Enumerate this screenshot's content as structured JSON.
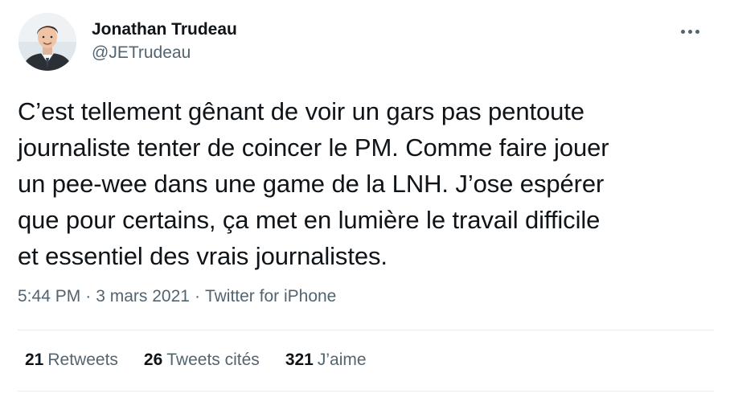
{
  "author": {
    "name": "Jonathan Trudeau",
    "handle": "@JETrudeau"
  },
  "tweet": {
    "lines": [
      "C’est tellement gênant de voir un gars pas pentoute",
      "journaliste tenter de coincer le PM. Comme faire jouer",
      "un pee-wee dans une game de la LNH. J’ose espérer",
      "que pour certains, ça met en lumière le travail difficile",
      "et essentiel des vrais journalistes."
    ]
  },
  "meta": {
    "time": "5:44 PM",
    "separator": "·",
    "date": "3 mars 2021",
    "source": "Twitter for iPhone"
  },
  "stats": {
    "retweets": {
      "count": "21",
      "label": "Retweets"
    },
    "quotes": {
      "count": "26",
      "label": "Tweets cités"
    },
    "likes": {
      "count": "321",
      "label": "J’aime"
    }
  },
  "icons": {
    "more": "more-horizontal-icon"
  },
  "colors": {
    "text": "#0f1419",
    "secondary": "#536471",
    "divider": "#e6ecf0"
  }
}
